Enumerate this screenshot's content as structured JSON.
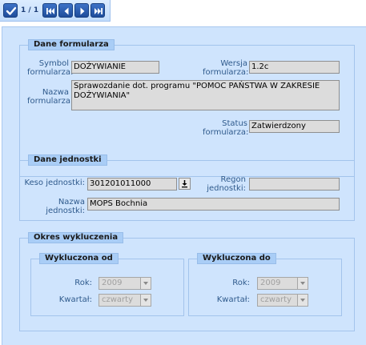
{
  "toolbar": {
    "pager": "1 / 1",
    "buttons": [
      "check-icon",
      "first-page-icon",
      "prev-page-icon",
      "next-page-icon",
      "last-page-icon"
    ]
  },
  "form": {
    "legend": "Dane formularza",
    "symbol_label_1": "Symbol",
    "symbol_label_2": "formularza:",
    "symbol_value": "DOŻYWIANIE",
    "version_label_1": "Wersja",
    "version_label_2": "formularza:",
    "version_value": "1.2c",
    "name_label_1": "Nazwa",
    "name_label_2": "formularza:",
    "name_value": "Sprawozdanie dot. programu \"POMOC PAŃSTWA W ZAKRESIE DOŻYWIANIA\"",
    "status_label_1": "Status",
    "status_label_2": "formularza:",
    "status_value": "Zatwierdzony"
  },
  "unit": {
    "legend": "Dane jednostki",
    "keso_label": "Keso jednostki:",
    "keso_value": "301201011000",
    "regon_label_1": "Regon",
    "regon_label_2": "jednostki:",
    "regon_value": "",
    "name_label_1": "Nazwa",
    "name_label_2": "jednostki:",
    "name_value": "MOPS Bochnia"
  },
  "exclusion": {
    "legend": "Okres wykluczenia",
    "from": {
      "legend": "Wykluczona od",
      "year_label": "Rok:",
      "year_value": "2009",
      "quarter_label": "Kwartał:",
      "quarter_value": "czwarty"
    },
    "to": {
      "legend": "Wykluczona do",
      "year_label": "Rok:",
      "year_value": "2009",
      "quarter_label": "Kwartał:",
      "quarter_value": "czwarty"
    }
  },
  "colors": {
    "panel": "#cfe4fd",
    "legend": "#a9cdf6",
    "label": "#2f5a8c",
    "toolbar_button": "#2a5cae"
  }
}
